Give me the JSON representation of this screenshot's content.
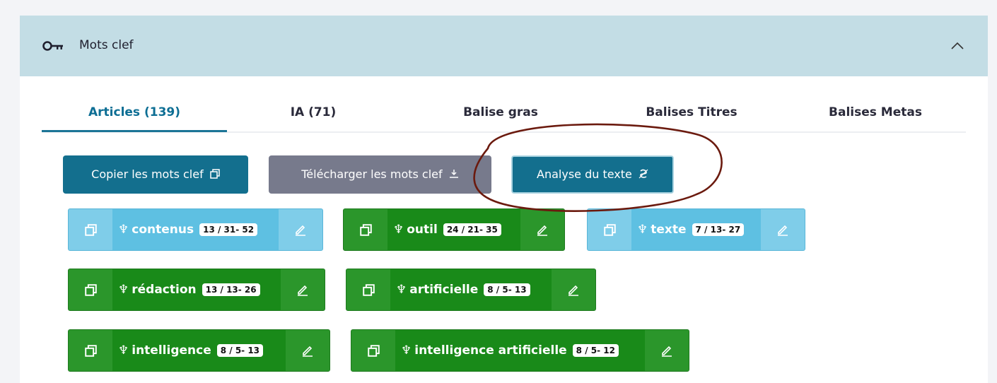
{
  "panel": {
    "title": "Mots clef",
    "icon": "key-icon",
    "collapse_icon": "chevron-up-icon"
  },
  "tabs": [
    {
      "label": "Articles (139)",
      "active": true
    },
    {
      "label": "IA (71)",
      "active": false
    },
    {
      "label": "Balise gras",
      "active": false
    },
    {
      "label": "Balises Titres",
      "active": false
    },
    {
      "label": "Balises Metas",
      "active": false
    }
  ],
  "actions": {
    "copy_label": "Copier les mots clef",
    "download_label": "Télécharger les mots clef",
    "analyse_label": "Analyse du texte"
  },
  "keywords": [
    {
      "word": "contenus",
      "count": "13 / 31- 52",
      "style": "light"
    },
    {
      "word": "outil",
      "count": "24 / 21- 35",
      "style": "green"
    },
    {
      "word": "texte",
      "count": "7 / 13- 27",
      "style": "light"
    },
    {
      "word": "rédaction",
      "count": "13 / 13- 26",
      "style": "green"
    },
    {
      "word": "artificielle",
      "count": "8 / 5- 13",
      "style": "green"
    },
    {
      "word": "intelligence",
      "count": "8 / 5- 13",
      "style": "green"
    },
    {
      "word": "intelligence artificielle",
      "count": "8 / 5- 12",
      "style": "green"
    }
  ],
  "colors": {
    "header_bg": "#c3dde5",
    "primary": "#136f8e",
    "secondary": "#777a8c",
    "keyword_light": "#5ec0e2",
    "keyword_green": "#198a19",
    "annotation_ellipse": "#6b1a0e"
  }
}
